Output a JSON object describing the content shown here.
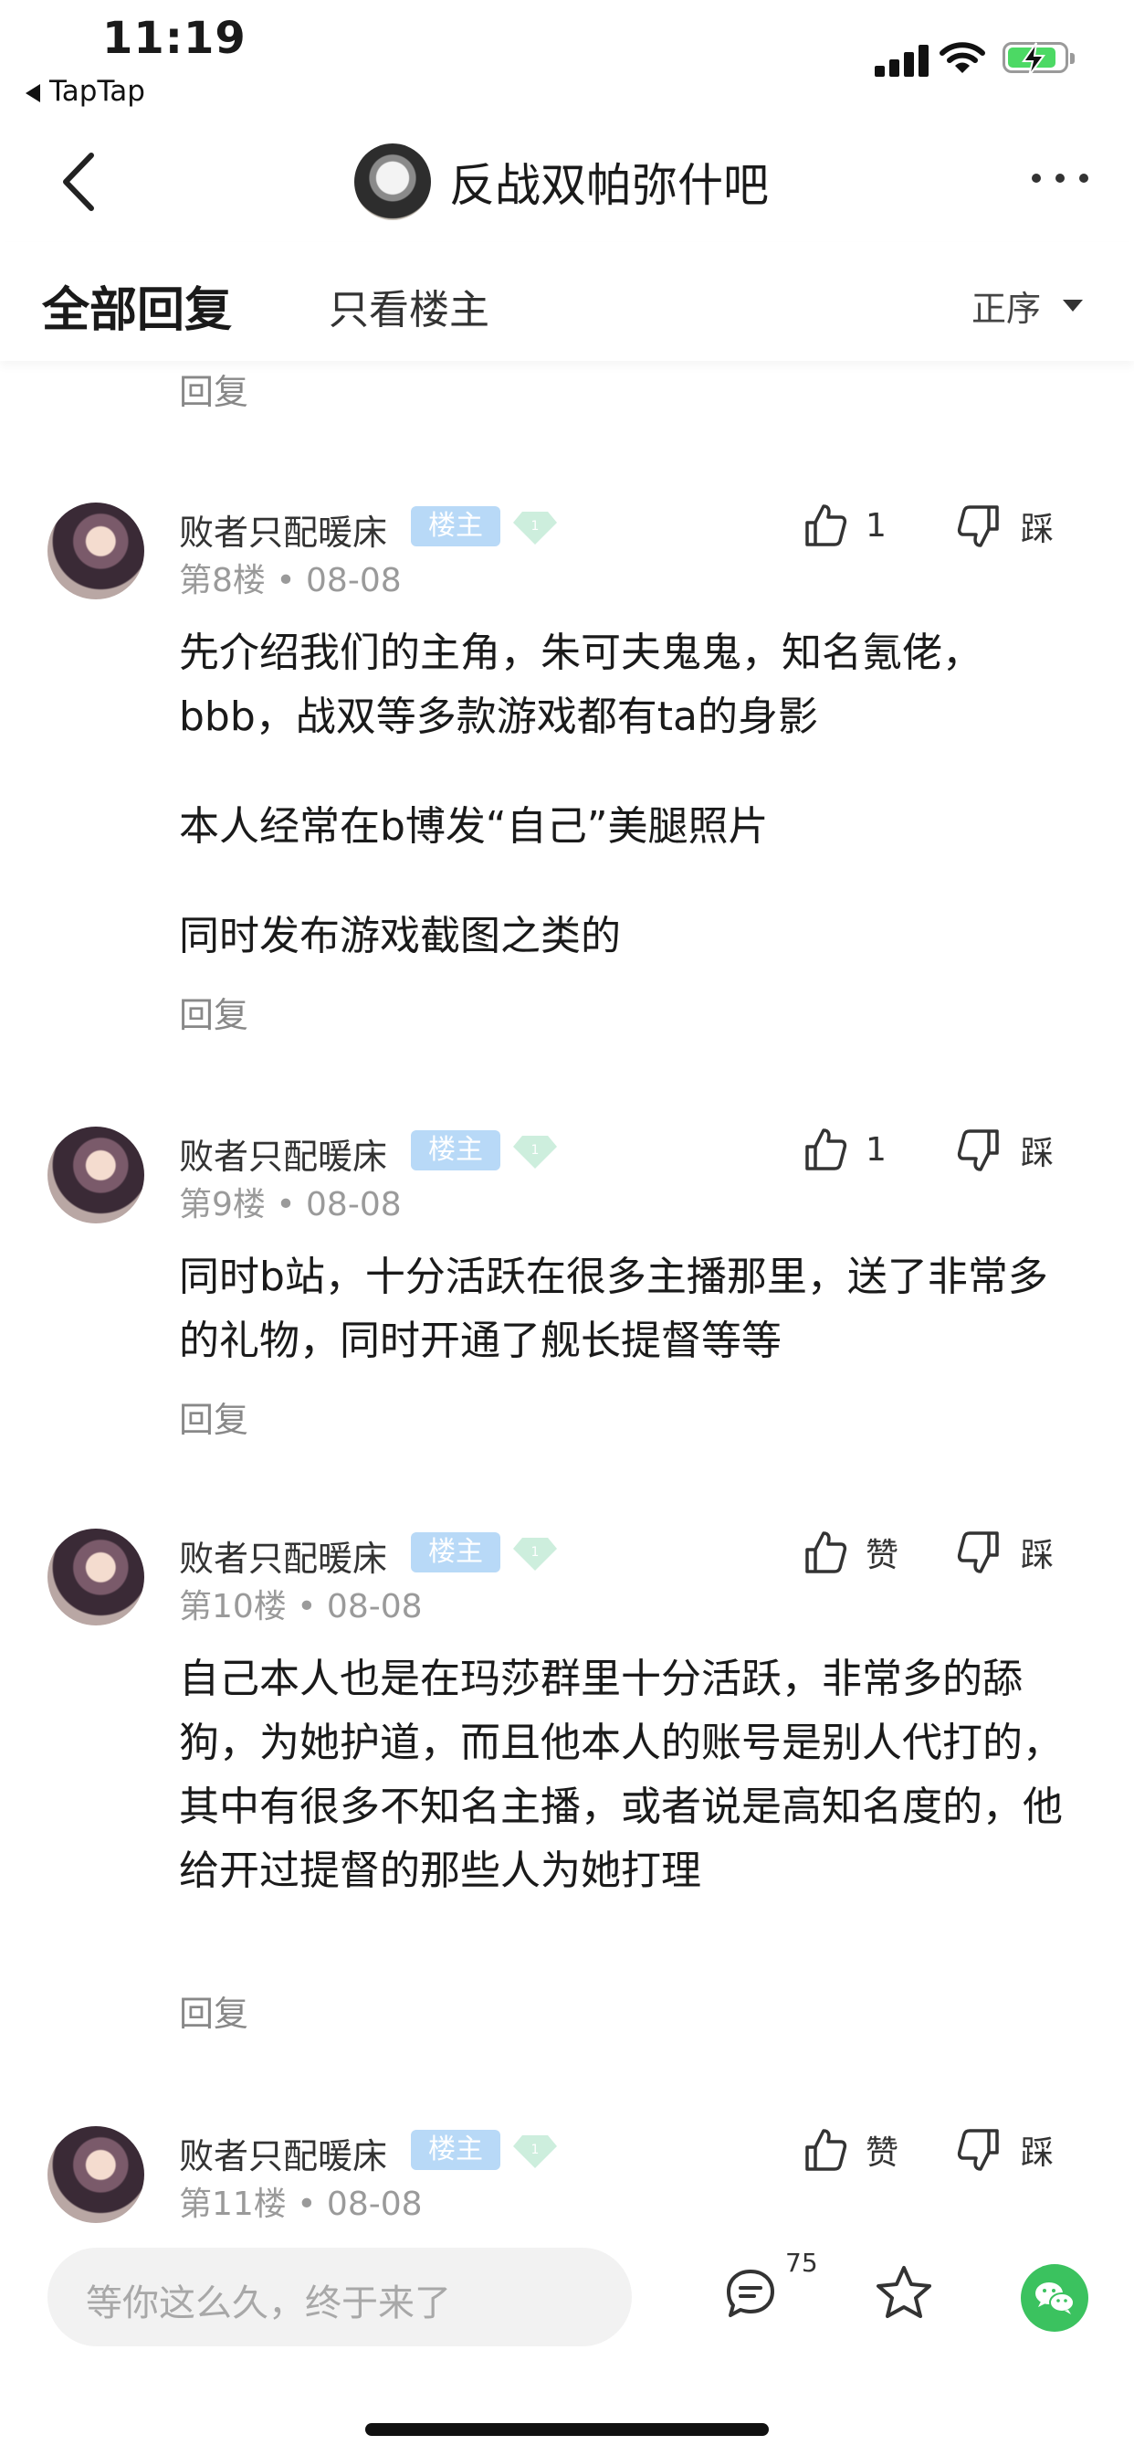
{
  "status": {
    "time": "11:19",
    "back_app": "TapTap"
  },
  "nav": {
    "forum_name": "反战双帕弥什吧"
  },
  "tabs": {
    "all": "全部回复",
    "op_only": "只看楼主",
    "sort": "正序"
  },
  "reply_label": "回复",
  "posts": [
    {
      "user": "败者只配暖床",
      "badge": "楼主",
      "floor": "第8楼",
      "date": "08-08",
      "meta": "第8楼 • 08-08",
      "likes": "1",
      "dislike_label": "踩",
      "paragraphs": [
        "先介绍我们的主角，朱可夫鬼鬼，知名氪佬，bbb，战双等多款游戏都有ta的身影",
        "本人经常在b博发“自己”美腿照片",
        "同时发布游戏截图之类的"
      ]
    },
    {
      "user": "败者只配暖床",
      "badge": "楼主",
      "floor": "第9楼",
      "date": "08-08",
      "meta": "第9楼 • 08-08",
      "likes": "1",
      "dislike_label": "踩",
      "paragraphs": [
        "同时b站，十分活跃在很多主播那里，送了非常多的礼物，同时开通了舰长提督等等"
      ]
    },
    {
      "user": "败者只配暖床",
      "badge": "楼主",
      "floor": "第10楼",
      "date": "08-08",
      "meta": "第10楼 • 08-08",
      "likes": "赞",
      "dislike_label": "踩",
      "paragraphs": [
        "自己本人也是在玛莎群里十分活跃，非常多的舔狗，为她护道，而且他本人的账号是别人代打的，其中有很多不知名主播，或者说是高知名度的，他给开过提督的那些人为她打理"
      ]
    },
    {
      "user": "败者只配暖床",
      "badge": "楼主",
      "floor": "第11楼",
      "date": "08-08",
      "meta": "第11楼 • 08-08",
      "likes": "赞",
      "dislike_label": "踩",
      "paragraphs": []
    }
  ],
  "bottom": {
    "placeholder": "等你这么久，终于来了",
    "comment_count": "75"
  },
  "colors": {
    "badge": "#b8d9f7",
    "wechat": "#3bc25f",
    "battery": "#4cd964"
  }
}
